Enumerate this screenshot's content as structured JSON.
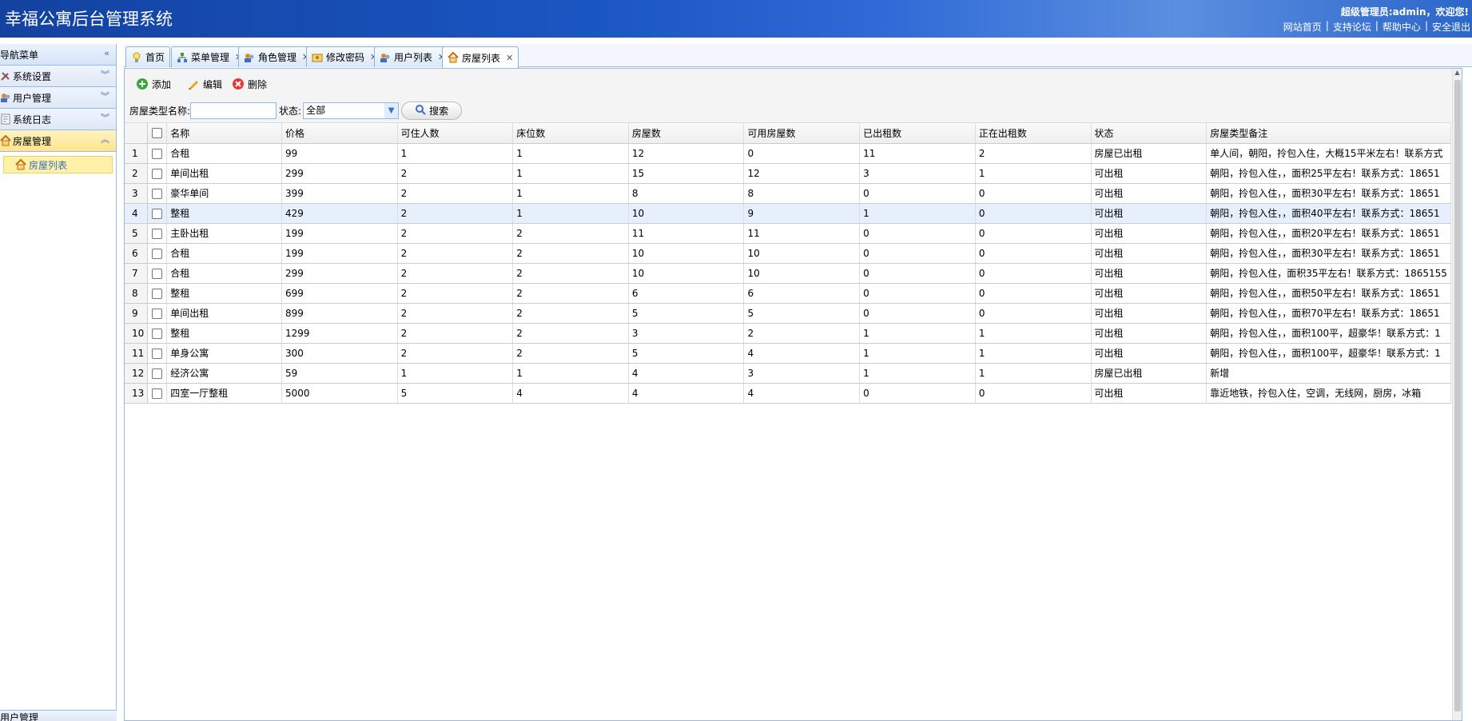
{
  "app": {
    "title": "幸福公寓后台管理系统",
    "greeting": "超级管理员:admin，欢迎您!",
    "links": [
      "网站首页",
      "支持论坛",
      "帮助中心",
      "安全退出"
    ]
  },
  "sidebar": {
    "nav_title": "导航菜单",
    "groups": [
      {
        "label": "系统设置"
      },
      {
        "label": "用户管理"
      },
      {
        "label": "系统日志"
      },
      {
        "label": "房屋管理"
      }
    ],
    "active_item": "房屋列表",
    "bottom_group": "用户管理"
  },
  "tabs": [
    {
      "label": "首页",
      "closable": false
    },
    {
      "label": "菜单管理",
      "closable": true
    },
    {
      "label": "角色管理",
      "closable": true
    },
    {
      "label": "修改密码",
      "closable": true
    },
    {
      "label": "用户列表",
      "closable": true
    },
    {
      "label": "房屋列表",
      "closable": true,
      "active": true
    }
  ],
  "toolbar": {
    "add": "添加",
    "edit": "编辑",
    "delete": "删除",
    "name_label": "房屋类型名称:",
    "name_value": "",
    "status_label": "状态:",
    "status_value": "全部",
    "search": "搜索"
  },
  "grid": {
    "columns": [
      "名称",
      "价格",
      "可住人数",
      "床位数",
      "房屋数",
      "可用房屋数",
      "已出租数",
      "正在出租数",
      "状态",
      "房屋类型备注"
    ],
    "highlight_row": 4,
    "rows": [
      [
        "合租",
        "99",
        "1",
        "1",
        "12",
        "0",
        "11",
        "2",
        "房屋已出租",
        "单人间，朝阳，拎包入住，大概15平米左右！联系方式"
      ],
      [
        "单间出租",
        "299",
        "2",
        "1",
        "15",
        "12",
        "3",
        "1",
        "可出租",
        "朝阳，拎包入住，，面积25平左右！联系方式：18651"
      ],
      [
        "豪华单间",
        "399",
        "2",
        "1",
        "8",
        "8",
        "0",
        "0",
        "可出租",
        "朝阳，拎包入住，，面积30平左右！联系方式：18651"
      ],
      [
        "整租",
        "429",
        "2",
        "1",
        "10",
        "9",
        "1",
        "0",
        "可出租",
        "朝阳，拎包入住，，面积40平左右！联系方式：18651"
      ],
      [
        "主卧出租",
        "199",
        "2",
        "2",
        "11",
        "11",
        "0",
        "0",
        "可出租",
        "朝阳，拎包入住，，面积20平左右！联系方式：18651"
      ],
      [
        "合租",
        "199",
        "2",
        "2",
        "10",
        "10",
        "0",
        "0",
        "可出租",
        "朝阳，拎包入住，，面积30平左右！联系方式：18651"
      ],
      [
        "合租",
        "299",
        "2",
        "2",
        "10",
        "10",
        "0",
        "0",
        "可出租",
        "朝阳，拎包入住，面积35平左右！联系方式：1865155"
      ],
      [
        "整租",
        "699",
        "2",
        "2",
        "6",
        "6",
        "0",
        "0",
        "可出租",
        "朝阳，拎包入住，，面积50平左右！联系方式：18651"
      ],
      [
        "单间出租",
        "899",
        "2",
        "2",
        "5",
        "5",
        "0",
        "0",
        "可出租",
        "朝阳，拎包入住，，面积70平左右！联系方式：18651"
      ],
      [
        "整租",
        "1299",
        "2",
        "2",
        "3",
        "2",
        "1",
        "1",
        "可出租",
        "朝阳，拎包入住，，面积100平，超豪华！联系方式：1"
      ],
      [
        "单身公寓",
        "300",
        "2",
        "2",
        "5",
        "4",
        "1",
        "1",
        "可出租",
        "朝阳，拎包入住，，面积100平，超豪华！联系方式：1"
      ],
      [
        "经济公寓",
        "59",
        "1",
        "1",
        "4",
        "3",
        "1",
        "1",
        "房屋已出租",
        "新增"
      ],
      [
        "四室一厅整租",
        "5000",
        "5",
        "4",
        "4",
        "4",
        "0",
        "0",
        "可出租",
        "靠近地铁，拎包入住，空调，无线网，厨房，冰箱"
      ]
    ]
  }
}
